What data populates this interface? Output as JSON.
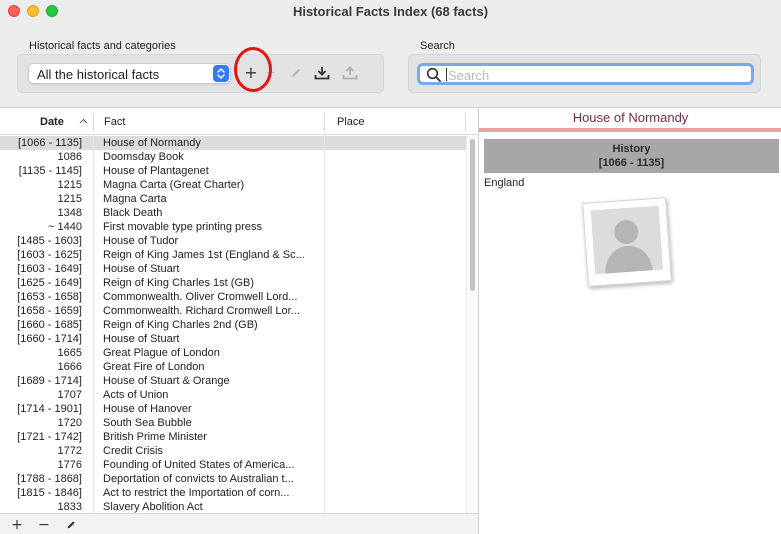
{
  "window": {
    "title": "Historical Facts Index (68 facts)"
  },
  "toolbar": {
    "facts_group_label": "Historical facts and categories",
    "category_select": {
      "selected": "All the historical facts"
    },
    "add_label": "+",
    "search_label": "Search",
    "search": {
      "placeholder": "Search",
      "value": ""
    }
  },
  "table": {
    "columns": {
      "date": "Date",
      "fact": "Fact",
      "place": "Place"
    },
    "rows": [
      {
        "date": "[1066 - 1135]",
        "fact": "House of Normandy",
        "place": "",
        "selected": true
      },
      {
        "date": "1086",
        "fact": "Doomsday Book",
        "place": ""
      },
      {
        "date": "[1135 - 1145]",
        "fact": "House of Plantagenet",
        "place": ""
      },
      {
        "date": "1215",
        "fact": "Magna Carta (Great Charter)",
        "place": ""
      },
      {
        "date": "1215",
        "fact": "Magna Carta",
        "place": ""
      },
      {
        "date": "1348",
        "fact": "Black Death",
        "place": ""
      },
      {
        "date": "~ 1440",
        "fact": "First movable type printing press",
        "place": ""
      },
      {
        "date": "[1485 - 1603]",
        "fact": "House of Tudor",
        "place": ""
      },
      {
        "date": "[1603 - 1625]",
        "fact": "Reign of King James 1st (England & Sc...",
        "place": ""
      },
      {
        "date": "[1603 - 1649]",
        "fact": "House of Stuart",
        "place": ""
      },
      {
        "date": "[1625 - 1649]",
        "fact": "Reign of King Charles 1st (GB)",
        "place": ""
      },
      {
        "date": "[1653 - 1658]",
        "fact": "Commonwealth. Oliver Cromwell Lord...",
        "place": ""
      },
      {
        "date": "[1658 - 1659]",
        "fact": "Commonwealth. Richard Cromwell Lor...",
        "place": ""
      },
      {
        "date": "[1660 - 1685]",
        "fact": "Reign of King Charles 2nd (GB)",
        "place": ""
      },
      {
        "date": "[1660 - 1714]",
        "fact": "House of Stuart",
        "place": ""
      },
      {
        "date": "1665",
        "fact": "Great Plague of London",
        "place": ""
      },
      {
        "date": "1666",
        "fact": "Great Fire of London",
        "place": ""
      },
      {
        "date": "[1689 - 1714]",
        "fact": "House of Stuart & Orange",
        "place": ""
      },
      {
        "date": "1707",
        "fact": "Acts of Union",
        "place": ""
      },
      {
        "date": "[1714 - 1901]",
        "fact": "House of Hanover",
        "place": ""
      },
      {
        "date": "1720",
        "fact": "South Sea Bubble",
        "place": ""
      },
      {
        "date": "[1721 - 1742]",
        "fact": "British Prime Minister",
        "place": ""
      },
      {
        "date": "1772",
        "fact": "Credit Crisis",
        "place": ""
      },
      {
        "date": "1776",
        "fact": "Founding of United States of America...",
        "place": ""
      },
      {
        "date": "[1788 - 1868]",
        "fact": "Deportation of convicts to Australian t...",
        "place": ""
      },
      {
        "date": "[1815 - 1846]",
        "fact": "Act to restrict the Importation of corn...",
        "place": ""
      },
      {
        "date": "1833",
        "fact": "Slavery Abolition Act",
        "place": ""
      }
    ],
    "footer": {
      "add": "+",
      "remove": "−"
    }
  },
  "detail": {
    "title": "House of Normandy",
    "category": "History",
    "period": "[1066 - 1135]",
    "place": "England"
  },
  "colors": {
    "selection": "#dcdcdc",
    "accent_blue": "#2f7cf6",
    "detail_title": "#7a2a4a",
    "detail_rule": "#eca2a2",
    "annotation_circle": "#e41414"
  },
  "icons": {
    "add": "plus-icon",
    "edit": "pencil-icon",
    "import": "download-tray-icon",
    "export": "upload-tray-icon",
    "search": "magnifier-icon",
    "photo": "person-silhouette-icon"
  }
}
